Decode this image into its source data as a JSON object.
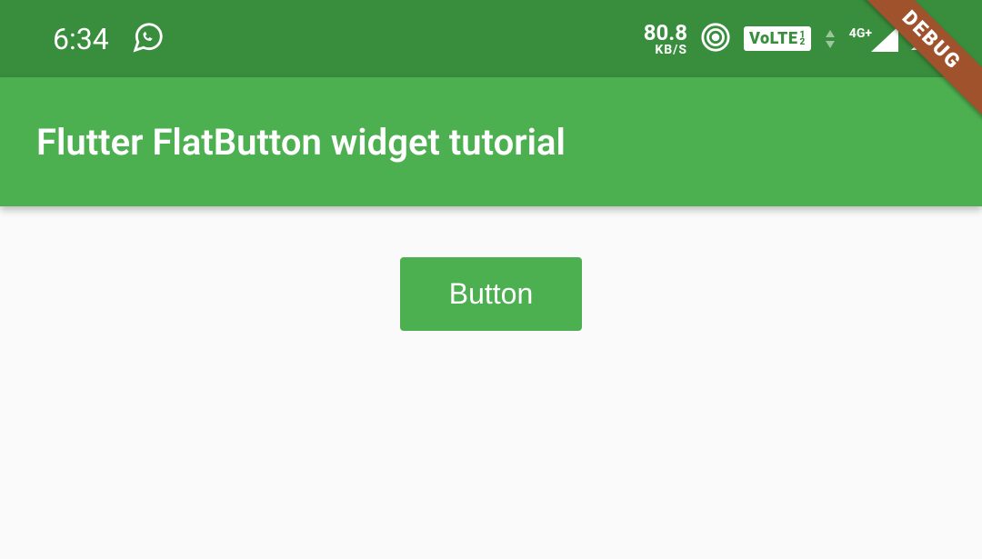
{
  "statusBar": {
    "time": "6:34",
    "networkSpeed": "80.8",
    "networkUnit": "KB/S",
    "volte": "VoLTE",
    "signal1Label": "4G+"
  },
  "appBar": {
    "title": "Flutter FlatButton widget tutorial"
  },
  "content": {
    "buttonLabel": "Button"
  },
  "debugBanner": "DEBUG"
}
